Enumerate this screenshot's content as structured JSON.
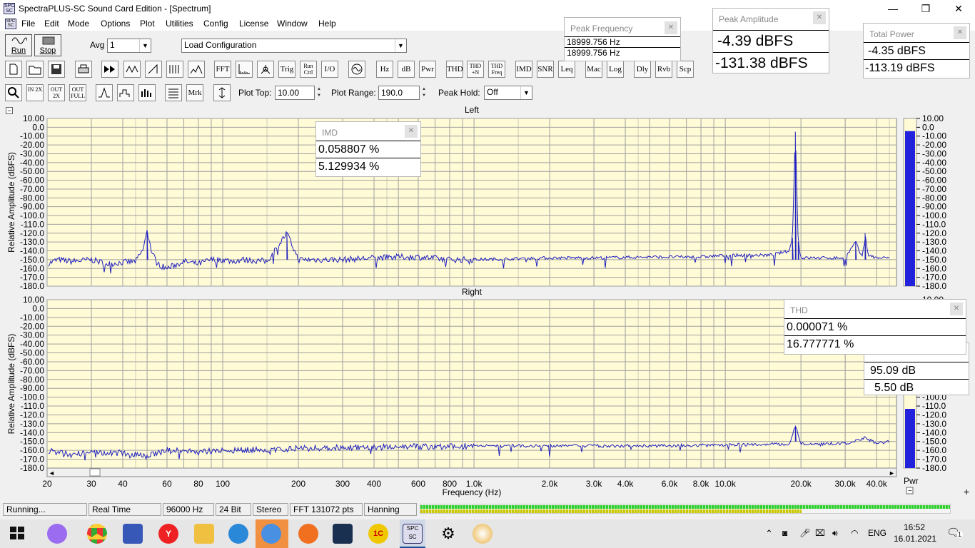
{
  "window": {
    "title": "SpectraPLUS-SC Sound Card Edition - [Spectrum]",
    "minimize": "—",
    "maximize": "❐",
    "close": "✕"
  },
  "menu": [
    "File",
    "Edit",
    "Mode",
    "Options",
    "Plot",
    "Utilities",
    "Config",
    "License",
    "Window",
    "Help"
  ],
  "toolbar1": {
    "run_label": "Run",
    "stop_label": "Stop",
    "avg_label": "Avg",
    "avg_value": "1",
    "config_value": "Load Configuration"
  },
  "toolbar2": [
    "FFT",
    "Trig",
    "Run Ctrl",
    "I/O",
    "Hz",
    "dB",
    "Pwr",
    "THD",
    "THD +N",
    "THD Freq",
    "IMD",
    "SNR",
    "Leq",
    "Mac",
    "Log",
    "Dly",
    "Rvb",
    "Scp"
  ],
  "toolbar3": {
    "mrk": "Mrk",
    "plot_top_label": "Plot Top:",
    "plot_top_value": "10.00",
    "plot_range_label": "Plot Range:",
    "plot_range_value": "190.0",
    "peak_hold_label": "Peak Hold:",
    "peak_hold_value": "Off",
    "zoom_in": "IN 2X",
    "zoom_out": "OUT 2X",
    "zoom_full": "OUT FULL"
  },
  "panels": {
    "peak_frequency": {
      "title": "Peak Frequency",
      "values": [
        "18999.756 Hz",
        "18999.756 Hz"
      ]
    },
    "peak_amplitude": {
      "title": "Peak Amplitude",
      "values": [
        "-4.39 dBFS",
        "-131.38 dBFS"
      ]
    },
    "total_power": {
      "title": "Total Power",
      "values": [
        "-4.35 dBFS",
        "-113.19 dBFS"
      ]
    },
    "imd": {
      "title": "IMD",
      "values": [
        "0.058807 %",
        "5.129934 %"
      ]
    },
    "thd": {
      "title": "THD",
      "values": [
        "0.000071 %",
        "16.777771 %"
      ]
    },
    "snr": {
      "values": [
        "95.09 dB",
        "5.50 dB"
      ]
    }
  },
  "chart_data": [
    {
      "type": "line",
      "title": "Left",
      "ylabel": "Relative Amplitude (dBFS)",
      "xscale": "log",
      "xlim": [
        20,
        48000
      ],
      "ylim": [
        -180,
        10
      ],
      "yticks": [
        "10.00",
        "0.0",
        "-10.00",
        "-20.00",
        "-30.00",
        "-40.00",
        "-50.00",
        "-60.00",
        "-70.00",
        "-80.00",
        "-90.00",
        "-100.0",
        "-110.0",
        "-120.0",
        "-130.0",
        "-140.0",
        "-150.0",
        "-160.0",
        "-170.0",
        "-180.0"
      ],
      "x": [
        20,
        22,
        25,
        30,
        35,
        40,
        45,
        48,
        50,
        52,
        55,
        60,
        70,
        80,
        90,
        100,
        110,
        120,
        150,
        180,
        200,
        250,
        300,
        400,
        500,
        600,
        800,
        1000,
        2000,
        3000,
        5000,
        8000,
        10000,
        15000,
        18000,
        18500,
        19000,
        19500,
        20000,
        25000,
        30000,
        33000,
        35000,
        36000,
        37000,
        40000,
        45000
      ],
      "y": [
        -155,
        -150,
        -152,
        -150,
        -155,
        -153,
        -152,
        -140,
        -118,
        -140,
        -155,
        -160,
        -152,
        -155,
        -150,
        -150,
        -152,
        -150,
        -152,
        -120,
        -150,
        -150,
        -150,
        -148,
        -147,
        -147,
        -150,
        -150,
        -148,
        -148,
        -147,
        -147,
        -145,
        -145,
        -140,
        -125,
        -5,
        -130,
        -148,
        -148,
        -148,
        -130,
        -148,
        -120,
        -145,
        -148,
        -148
      ],
      "series": [
        {
          "name": "",
          "values": []
        }
      ],
      "legend": "none",
      "grid": true,
      "grid_color": "#a0a0a0",
      "plot_bg": "#fffbd6",
      "line_color": "#1f1fbf"
    },
    {
      "type": "line",
      "title": "Right",
      "xlabel": "Frequency (Hz)",
      "ylabel": "Relative Amplitude (dBFS)",
      "xscale": "log",
      "xlim": [
        20,
        48000
      ],
      "ylim": [
        -180,
        10
      ],
      "yticks": [
        "10.00",
        "0.0",
        "-10.00",
        "-20.00",
        "-30.00",
        "-40.00",
        "-50.00",
        "-60.00",
        "-70.00",
        "-80.00",
        "-90.00",
        "-100.0",
        "-110.0",
        "-120.0",
        "-130.0",
        "-140.0",
        "-150.0",
        "-160.0",
        "-170.0",
        "-180.0"
      ],
      "xticks": [
        "20",
        "30",
        "40",
        "60",
        "80",
        "100",
        "200",
        "300",
        "400",
        "600",
        "800",
        "1.0k",
        "2.0k",
        "3.0k",
        "4.0k",
        "6.0k",
        "8.0k",
        "10.0k",
        "20.0k",
        "30.0k",
        "40.0k"
      ],
      "xtick_values": [
        20,
        30,
        40,
        60,
        80,
        100,
        200,
        300,
        400,
        600,
        800,
        1000,
        2000,
        3000,
        4000,
        6000,
        8000,
        10000,
        20000,
        30000,
        40000
      ],
      "x": [
        20,
        25,
        30,
        40,
        50,
        60,
        80,
        100,
        200,
        500,
        1000,
        2000,
        5000,
        10000,
        18000,
        19000,
        20000,
        30000,
        36000,
        40000,
        45000
      ],
      "y": [
        -160,
        -165,
        -162,
        -163,
        -165,
        -160,
        -162,
        -160,
        -158,
        -156,
        -155,
        -155,
        -155,
        -154,
        -153,
        -132,
        -153,
        -152,
        -146,
        -152,
        -150
      ],
      "legend": "none",
      "grid": true,
      "line_color": "#1f1fbf"
    }
  ],
  "meters": {
    "left": {
      "label": "Pwr",
      "level_db": -4.35
    },
    "right": {
      "label": "Pwr",
      "level_db": -113.19
    },
    "scale": [
      "10.00",
      "0.0",
      "-10.00",
      "-20.00",
      "-30.00",
      "-40.00",
      "-50.00",
      "-60.00",
      "-70.00",
      "-80.00",
      "-90.00",
      "-100.0",
      "-110.0",
      "-120.0",
      "-130.0",
      "-140.0",
      "-150.0",
      "-160.0",
      "-170.0",
      "-180.0"
    ],
    "color": "#2222dd"
  },
  "status": [
    "Running...",
    "Real Time",
    "96000 Hz",
    "24 Bit",
    "Stereo",
    "FFT 131072 pts",
    "Hanning"
  ],
  "taskbar": {
    "time": "16:52",
    "date": "16.01.2021",
    "lang": "ENG",
    "notif": "1",
    "icons": [
      "windows-start-icon",
      "alice-assistant-icon",
      "chrome-icon",
      "save-disk-icon",
      "yandex-browser-icon",
      "file-explorer-icon",
      "app-blue-icon",
      "app-active-icon",
      "app-orange-icon",
      "cloud-app-icon",
      "1c-icon",
      "spectraplus-icon",
      "settings-icon",
      "paint-icon"
    ]
  }
}
